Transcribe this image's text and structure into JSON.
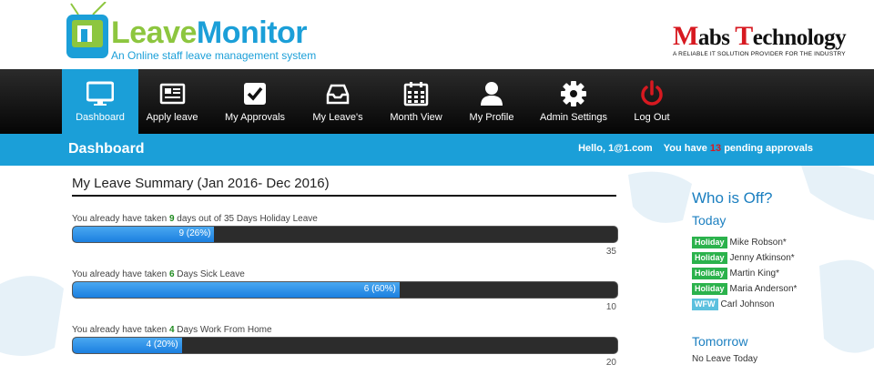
{
  "brand": {
    "logo_word_1": "Leave",
    "logo_word_2": "Monitor",
    "logo_tagline": "An Online staff leave management system",
    "company_first_initial": "M",
    "company_first_rest": "abs ",
    "company_second_initial": "T",
    "company_second_rest": "echnology",
    "company_tagline": "A RELIABLE IT SOLUTION PROVIDER FOR THE INDUSTRY"
  },
  "nav": {
    "items": [
      {
        "label": "Dashboard",
        "icon": "monitor-icon",
        "active": true
      },
      {
        "label": "Apply leave",
        "icon": "newspaper-icon",
        "active": false
      },
      {
        "label": "My Approvals",
        "icon": "checkbox-icon",
        "active": false
      },
      {
        "label": "My Leave's",
        "icon": "inbox-icon",
        "active": false
      },
      {
        "label": "Month View",
        "icon": "calendar-icon",
        "active": false
      },
      {
        "label": "My Profile",
        "icon": "user-icon",
        "active": false
      },
      {
        "label": "Admin Settings",
        "icon": "gear-icon",
        "active": false
      },
      {
        "label": "Log Out",
        "icon": "power-icon",
        "active": false
      }
    ]
  },
  "status_bar": {
    "page_title": "Dashboard",
    "greeting": "Hello, 1@1.com",
    "pending_prefix": "You have",
    "pending_count": "13",
    "pending_suffix": "pending approvals"
  },
  "summary": {
    "title": "My Leave Summary (Jan 2016- Dec 2016)",
    "items": [
      {
        "prefix": "You already have taken",
        "taken": "9",
        "suffix": "days out of 35 Days Holiday Leave",
        "bar_label": "9 (26%)",
        "fraction": 0.26,
        "total": "35"
      },
      {
        "prefix": "You already have taken",
        "taken": "6",
        "suffix": "Days Sick Leave",
        "bar_label": "6 (60%)",
        "fraction": 0.6,
        "total": "10"
      },
      {
        "prefix": "You already have taken",
        "taken": "4",
        "suffix": "Days Work From Home",
        "bar_label": "4 (20%)",
        "fraction": 0.2,
        "total": "20"
      }
    ]
  },
  "who_is_off": {
    "title": "Who is Off?",
    "today_label": "Today",
    "today": [
      {
        "badge": "Holiday",
        "name": "Mike Robson*"
      },
      {
        "badge": "Holiday",
        "name": "Jenny Atkinson*"
      },
      {
        "badge": "Holiday",
        "name": "Martin King*"
      },
      {
        "badge": "Holiday",
        "name": "Maria Anderson*"
      },
      {
        "badge": "WFW",
        "name": "Carl Johnson"
      }
    ],
    "tomorrow_label": "Tomorrow",
    "tomorrow_text": "No Leave Today"
  },
  "colors": {
    "accent_blue": "#1b9fd8",
    "brand_green": "#8dc63f",
    "alert_red": "#d71920",
    "holiday_green": "#2bb24c",
    "wfw_blue": "#5bc0de"
  }
}
